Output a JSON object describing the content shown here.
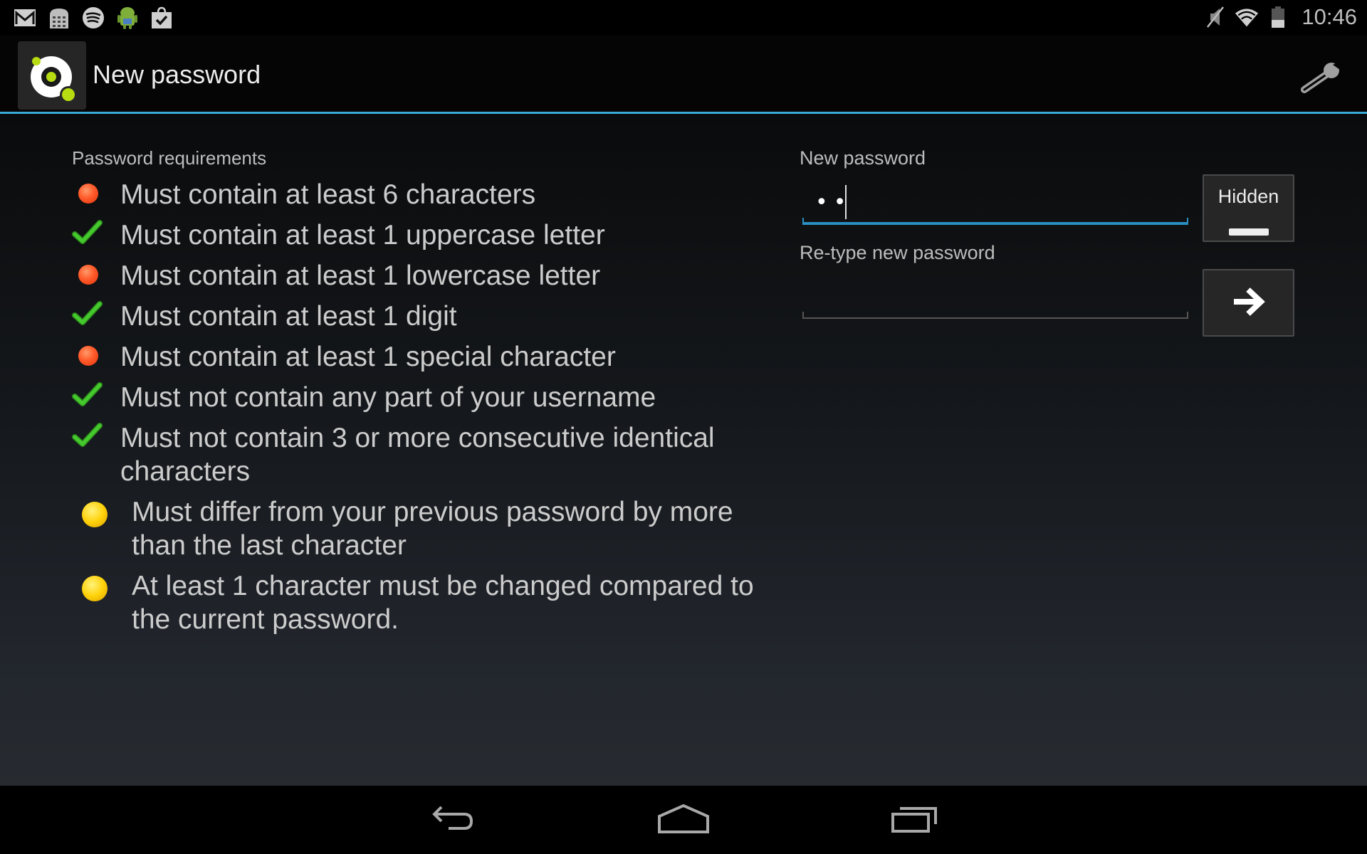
{
  "status_bar": {
    "notification_icons": [
      "gmail-icon",
      "calculator-icon",
      "spotify-icon",
      "android-icon",
      "shopping-bag-check-icon"
    ],
    "system_icons": [
      "muted-icon",
      "wifi-icon",
      "battery-icon"
    ],
    "time": "10:46"
  },
  "action_bar": {
    "title": "New password",
    "accent_color": "#3ba9d8",
    "settings_icon": "wrench-icon"
  },
  "requirements": {
    "heading": "Password requirements",
    "items": [
      {
        "text": "Must contain at least 6 characters",
        "status": "fail"
      },
      {
        "text": "Must contain at least 1 uppercase letter",
        "status": "ok"
      },
      {
        "text": "Must contain at least 1 lowercase letter",
        "status": "fail"
      },
      {
        "text": "Must contain at least 1 digit",
        "status": "ok"
      },
      {
        "text": "Must contain at least 1 special character",
        "status": "fail"
      },
      {
        "text": "Must not contain any part of your username",
        "status": "ok"
      },
      {
        "text": "Must not contain 3 or more consecutive identical characters",
        "status": "ok"
      },
      {
        "text": "Must differ from your previous password by more than the last character",
        "status": "pending"
      },
      {
        "text": "At least 1 character must be changed compared to the current password.",
        "status": "pending"
      }
    ],
    "status_colors": {
      "ok": "#3fbf2a",
      "fail": "#ff5a2a",
      "pending": "#ffd20a"
    }
  },
  "form": {
    "new_password_label": "New password",
    "new_password_value": "••",
    "retype_label": "Re-type new password",
    "retype_value": "",
    "visibility_button_label": "Hidden",
    "submit_button_icon": "arrow-right-icon"
  },
  "nav_bar": {
    "buttons": [
      "back",
      "home",
      "recent-apps"
    ]
  }
}
